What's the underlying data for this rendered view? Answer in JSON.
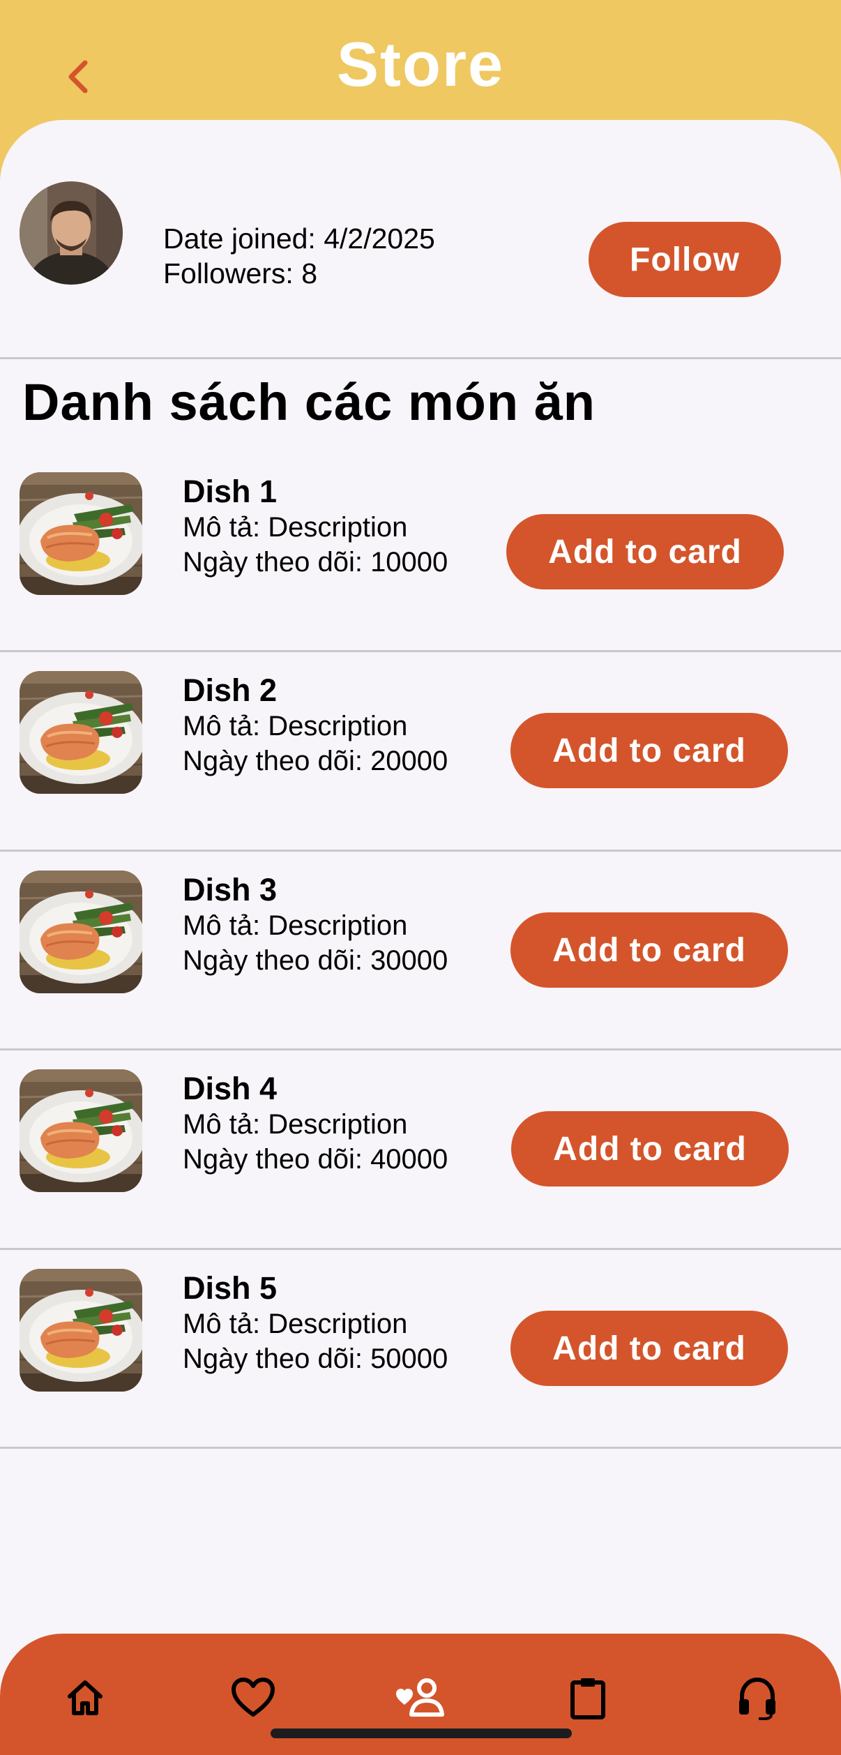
{
  "header": {
    "title": "Store",
    "back_icon": "chevron-left-icon"
  },
  "colors": {
    "header_bg": "#efc862",
    "accent": "#d4552b",
    "sheet_bg": "#f7f5f9"
  },
  "profile": {
    "date_joined": "Date joined: 4/2/2025",
    "followers": "Followers: 8",
    "follow_label": "Follow"
  },
  "section_title": "Danh sách các món ăn",
  "dishes": [
    {
      "name": "Dish 1",
      "description": "Mô tả: Description",
      "follow_date": "Ngày theo dõi: 10000",
      "button": "Add to card"
    },
    {
      "name": "Dish 2",
      "description": "Mô tả: Description",
      "follow_date": "Ngày theo dõi: 20000",
      "button": "Add to card"
    },
    {
      "name": "Dish 3",
      "description": "Mô tả: Description",
      "follow_date": "Ngày theo dõi: 30000",
      "button": "Add to card"
    },
    {
      "name": "Dish 4",
      "description": "Mô tả: Description",
      "follow_date": "Ngày theo dõi: 40000",
      "button": "Add to card"
    },
    {
      "name": "Dish 5",
      "description": "Mô tả: Description",
      "follow_date": "Ngày theo dõi: 50000",
      "button": "Add to card"
    }
  ],
  "nav": [
    "home-icon",
    "heart-icon",
    "follow-user-icon",
    "clipboard-icon",
    "headphones-icon"
  ]
}
